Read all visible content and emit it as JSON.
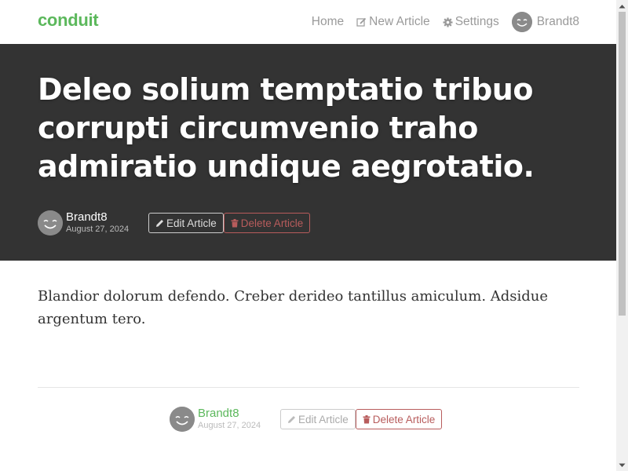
{
  "navbar": {
    "brand": "conduit",
    "links": {
      "home": "Home",
      "new_article": "New Article",
      "settings": "Settings",
      "profile": "Brandt8"
    }
  },
  "article": {
    "title": "Deleo solium temptatio tribuo corrupti circumvenio traho admiratio undique aegrotatio.",
    "author": "Brandt8",
    "date": "August 27, 2024",
    "body": "Blandior dolorum defendo. Creber derideo tantillus amiculum. Adsidue argentum tero."
  },
  "actions": {
    "edit_label": "Edit Article",
    "delete_label": "Delete Article"
  },
  "icons": {
    "new_article": "edit-icon",
    "settings": "gear-icon",
    "edit": "pencil-icon",
    "delete": "trash-icon",
    "avatar": "smiley-avatar"
  },
  "colors": {
    "brand": "#5cb85c",
    "banner": "#333333",
    "danger": "#b85c5c",
    "nav_text": "#9a9a9a"
  }
}
